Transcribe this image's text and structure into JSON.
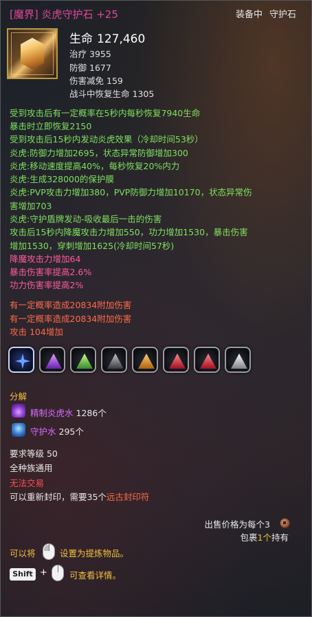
{
  "item": {
    "title": "[魔界] 炎虎守护石 +25",
    "status_equipped": "装备中",
    "status_type": "守护石",
    "icon": "guardian-stone-icon"
  },
  "stats": {
    "main_label": "生命",
    "main_value": "127,460",
    "lines": [
      {
        "label": "治疗",
        "value": "3955"
      },
      {
        "label": "防御",
        "value": "1677"
      },
      {
        "label": "伤害减免",
        "value": "159"
      },
      {
        "label": "战斗中恢复生命",
        "value": "1305"
      }
    ]
  },
  "effects_green": [
    "受到攻击后有一定概率在5秒内每秒恢复7940生命",
    "暴击时立即恢复2150",
    "受到攻击后15秒内发动炎虎效果（冷却时间53秒）",
    "炎虎:防御力增加2695，状态异常防御增加300",
    "炎虎:移动速度提高40%，每秒恢复20%内力",
    "炎虎:生成328000的保护膜",
    "炎虎:PVP攻击力增加380，PVP防御力增加10170，状态异常伤",
    "害增加703",
    "炎虎:守护盾牌发动-吸收最后一击的伤害",
    "攻击后15秒内降魔攻击力增加550，功力增加1530，暴击伤害",
    "增加1530，穿刺增加1625(冷却时间57秒)"
  ],
  "effects_pink": [
    "降魔攻击力增加64",
    "暴击伤害率提高2.6%",
    "功力伤害率提高2%"
  ],
  "effects_orange": [
    "有一定概率造成20834附加伤害",
    "有一定概率造成20834附加伤害",
    "攻击 104增加"
  ],
  "sockets": [
    {
      "name": "socket-blue-star-icon",
      "color": "#6fa0ff"
    },
    {
      "name": "socket-purple-icon",
      "color": "#a050e0"
    },
    {
      "name": "socket-green-icon",
      "color": "#80d060"
    },
    {
      "name": "socket-dark-icon",
      "color": "#8a8a90"
    },
    {
      "name": "socket-orange-icon",
      "color": "#f0a030"
    },
    {
      "name": "socket-red-icon",
      "color": "#e03040"
    },
    {
      "name": "socket-red-icon",
      "color": "#e03040"
    },
    {
      "name": "socket-white-icon",
      "color": "#d8d8e0"
    }
  ],
  "disassemble": {
    "heading": "分解",
    "materials": [
      {
        "name": "精制炎虎水",
        "count": "1286个",
        "icon": "refined-tiger-water-icon"
      },
      {
        "name": "守护水",
        "count": "295个",
        "icon": "guardian-water-icon"
      }
    ]
  },
  "requirements": {
    "level": "要求等级 50",
    "race": "全种族通用",
    "trade": "无法交易",
    "reseal_prefix": "可以重新封印，需要35个",
    "reseal_item": "远古封印符"
  },
  "sell": {
    "price_label": "出售价格为每个3",
    "bag_prefix": "包裹",
    "bag_count": "1个",
    "bag_suffix": "持有"
  },
  "hints": {
    "refine_prefix": "可以将",
    "refine_suffix": "设置为提炼物品。",
    "shift_key": "Shift",
    "plus": "+",
    "detail_suffix": "可查看详情。"
  },
  "colors": {
    "title": "#e2479b",
    "green_effect": "#7fe05e",
    "pink_effect": "#ff5aa0",
    "orange_effect": "#ff6a4a",
    "material": "#d96cff",
    "accent_yellow": "#f0c040",
    "untradeable": "#ff4d4d"
  }
}
